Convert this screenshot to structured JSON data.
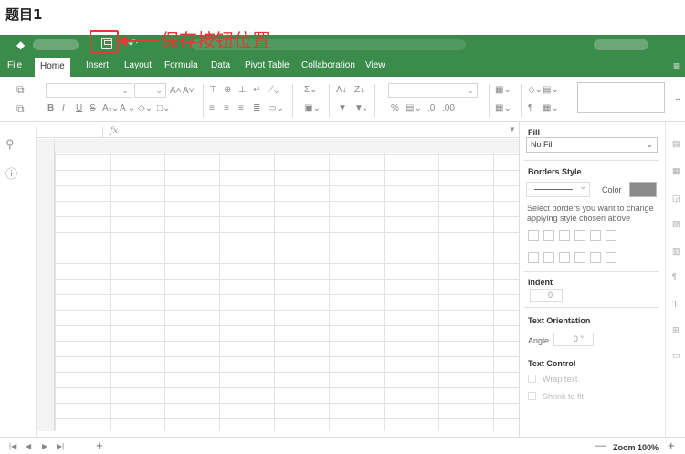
{
  "question": {
    "title": "题目1"
  },
  "annotation": {
    "text": "保存按钮位置"
  },
  "menu": {
    "items": [
      "File",
      "Home",
      "Insert",
      "Layout",
      "Formula",
      "Data",
      "Pivot Table",
      "Collaboration",
      "View"
    ],
    "active": "Home"
  },
  "formula_bar": {
    "fx": "fx"
  },
  "panel": {
    "fill_title": "Fill",
    "fill_value": "No Fill",
    "borders_title": "Borders Style",
    "color_label": "Color",
    "borders_hint": "Select borders you want to change applying style chosen above",
    "indent_title": "Indent",
    "indent_value": "0",
    "orientation_title": "Text Orientation",
    "angle_label": "Angle",
    "angle_value": "0 °",
    "text_control_title": "Text Control",
    "wrap_label": "Wrap text",
    "shrink_label": "Shrink to fit"
  },
  "status": {
    "zoom": "Zoom 100%",
    "minus": "—",
    "plus": "+",
    "add_sheet": "+"
  },
  "colors": {
    "accent": "#3b8b4a",
    "annotation": "#e53935"
  }
}
